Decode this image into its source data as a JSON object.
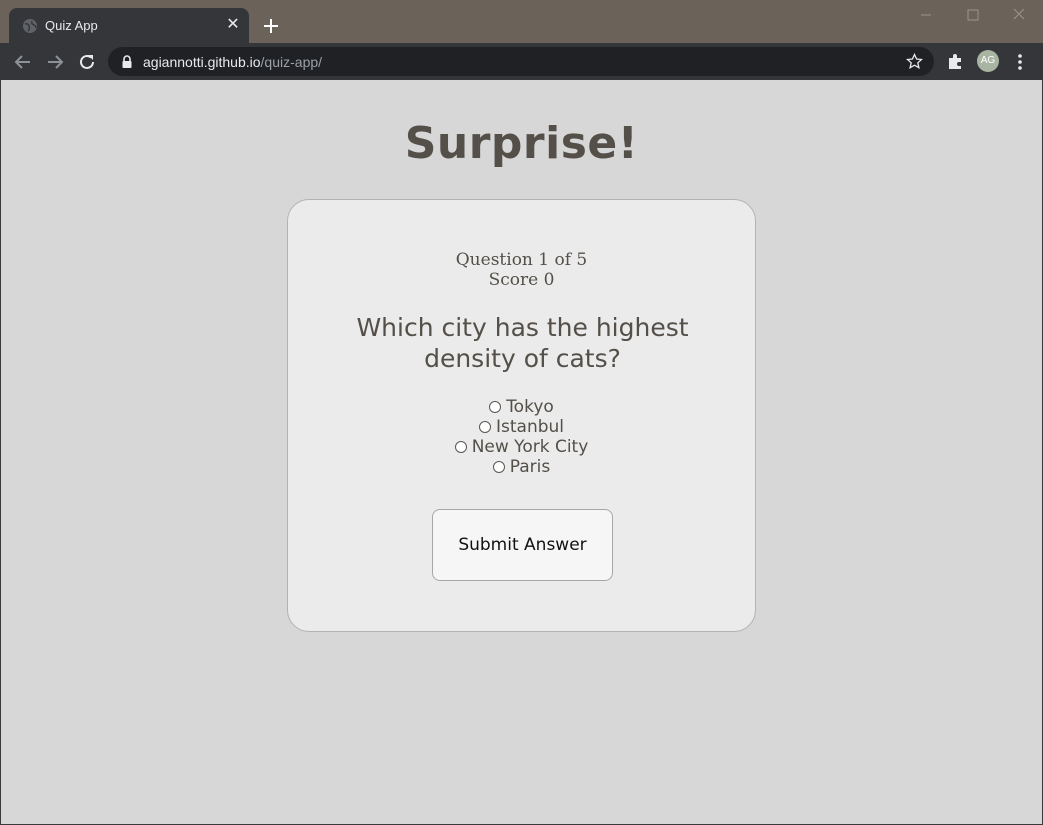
{
  "browser": {
    "tab_title": "Quiz App",
    "tab_close": "✕",
    "url_host": "agiannotti.github.io",
    "url_path": "/quiz-app/",
    "avatar_initials": "AG",
    "colors": {
      "frame": "#6b625a",
      "toolbar": "#35363a",
      "omnibox": "#202124"
    }
  },
  "page": {
    "title": "Surprise!",
    "quiz": {
      "progress": "Question 1 of 5",
      "score": "Score 0",
      "question": "Which city has the highest density of cats?",
      "options": [
        "Tokyo",
        "Istanbul",
        "New York City",
        "Paris"
      ],
      "submit_label": "Submit Answer"
    },
    "colors": {
      "background": "#d7d7d7",
      "card": "#ebebeb",
      "text": "#544f49"
    }
  }
}
